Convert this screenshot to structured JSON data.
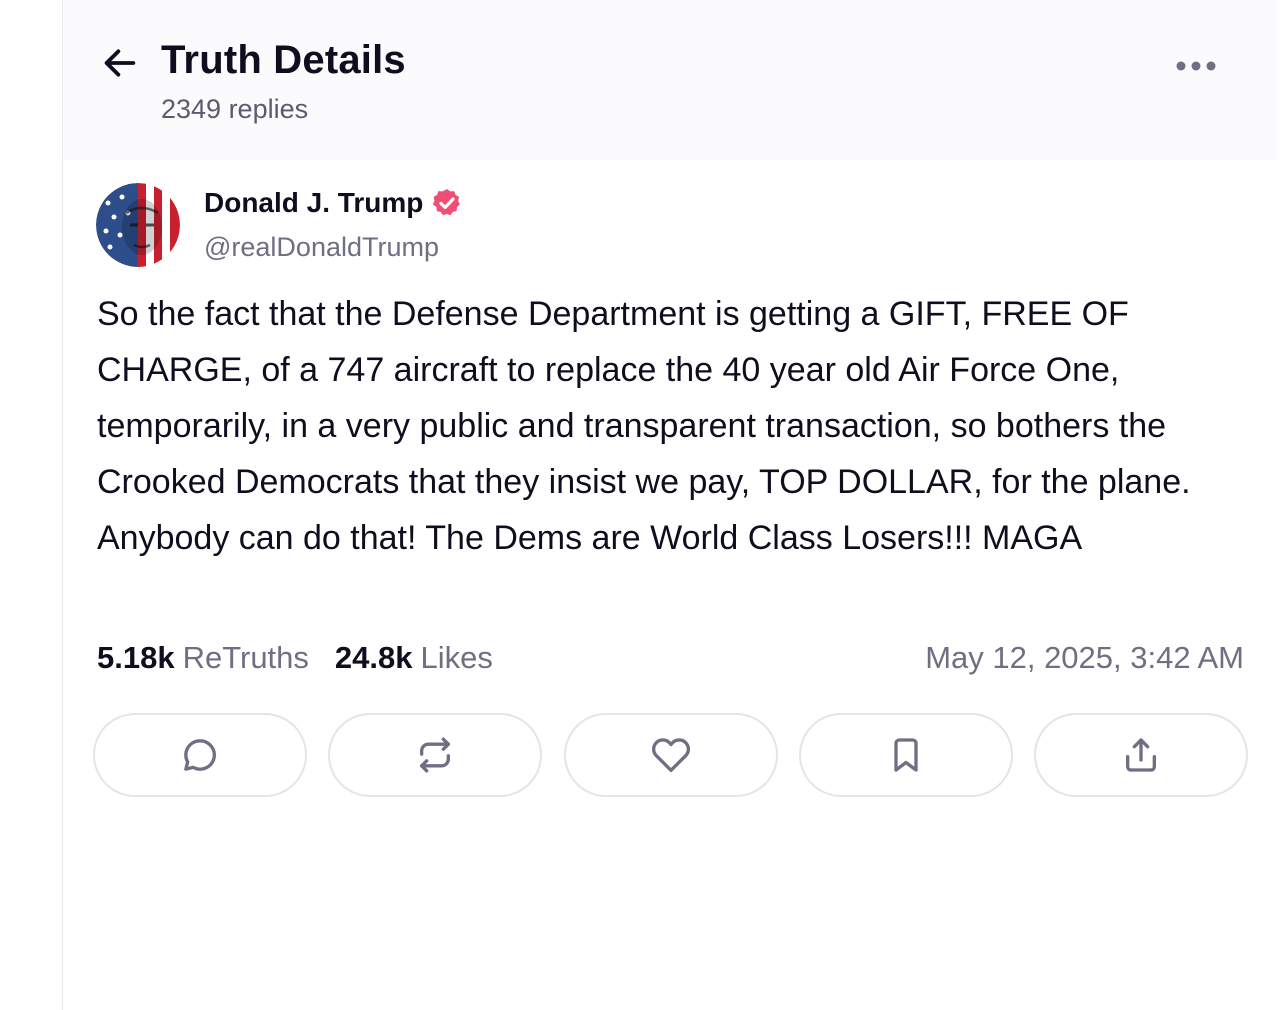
{
  "header": {
    "title": "Truth Details",
    "reply_count": "2349 replies",
    "icons": {
      "back": "arrow-left-icon",
      "more": "more-horizontal-icon"
    }
  },
  "author": {
    "display_name": "Donald J. Trump",
    "handle": "@realDonaldTrump",
    "verified": true,
    "verified_color": "#ef4f75",
    "avatar_icon": "avatar-image"
  },
  "post": {
    "text": "So the fact that the Defense Department is getting a GIFT, FREE OF CHARGE, of a 747 aircraft to replace the 40 year old Air Force One, temporarily, in a very public and transparent transaction, so bothers the Crooked Democrats that they insist we pay, TOP DOLLAR, for the plane. Anybody can do that! The Dems are World Class Losers!!! MAGA",
    "retruths_count": "5.18k",
    "retruths_label": "ReTruths",
    "likes_count": "24.8k",
    "likes_label": "Likes",
    "timestamp": "May 12, 2025, 3:42 AM"
  },
  "actions": [
    {
      "name": "reply",
      "icon": "comment-icon"
    },
    {
      "name": "retruth",
      "icon": "repost-icon"
    },
    {
      "name": "like",
      "icon": "heart-icon"
    },
    {
      "name": "bookmark",
      "icon": "bookmark-icon"
    },
    {
      "name": "share",
      "icon": "share-icon"
    }
  ],
  "colors": {
    "text_primary": "#0f0e1f",
    "text_secondary": "#6f6f84",
    "icon_gray": "#6f6f84",
    "border": "#e4e4ea",
    "header_bg": "#fbfbfd"
  }
}
